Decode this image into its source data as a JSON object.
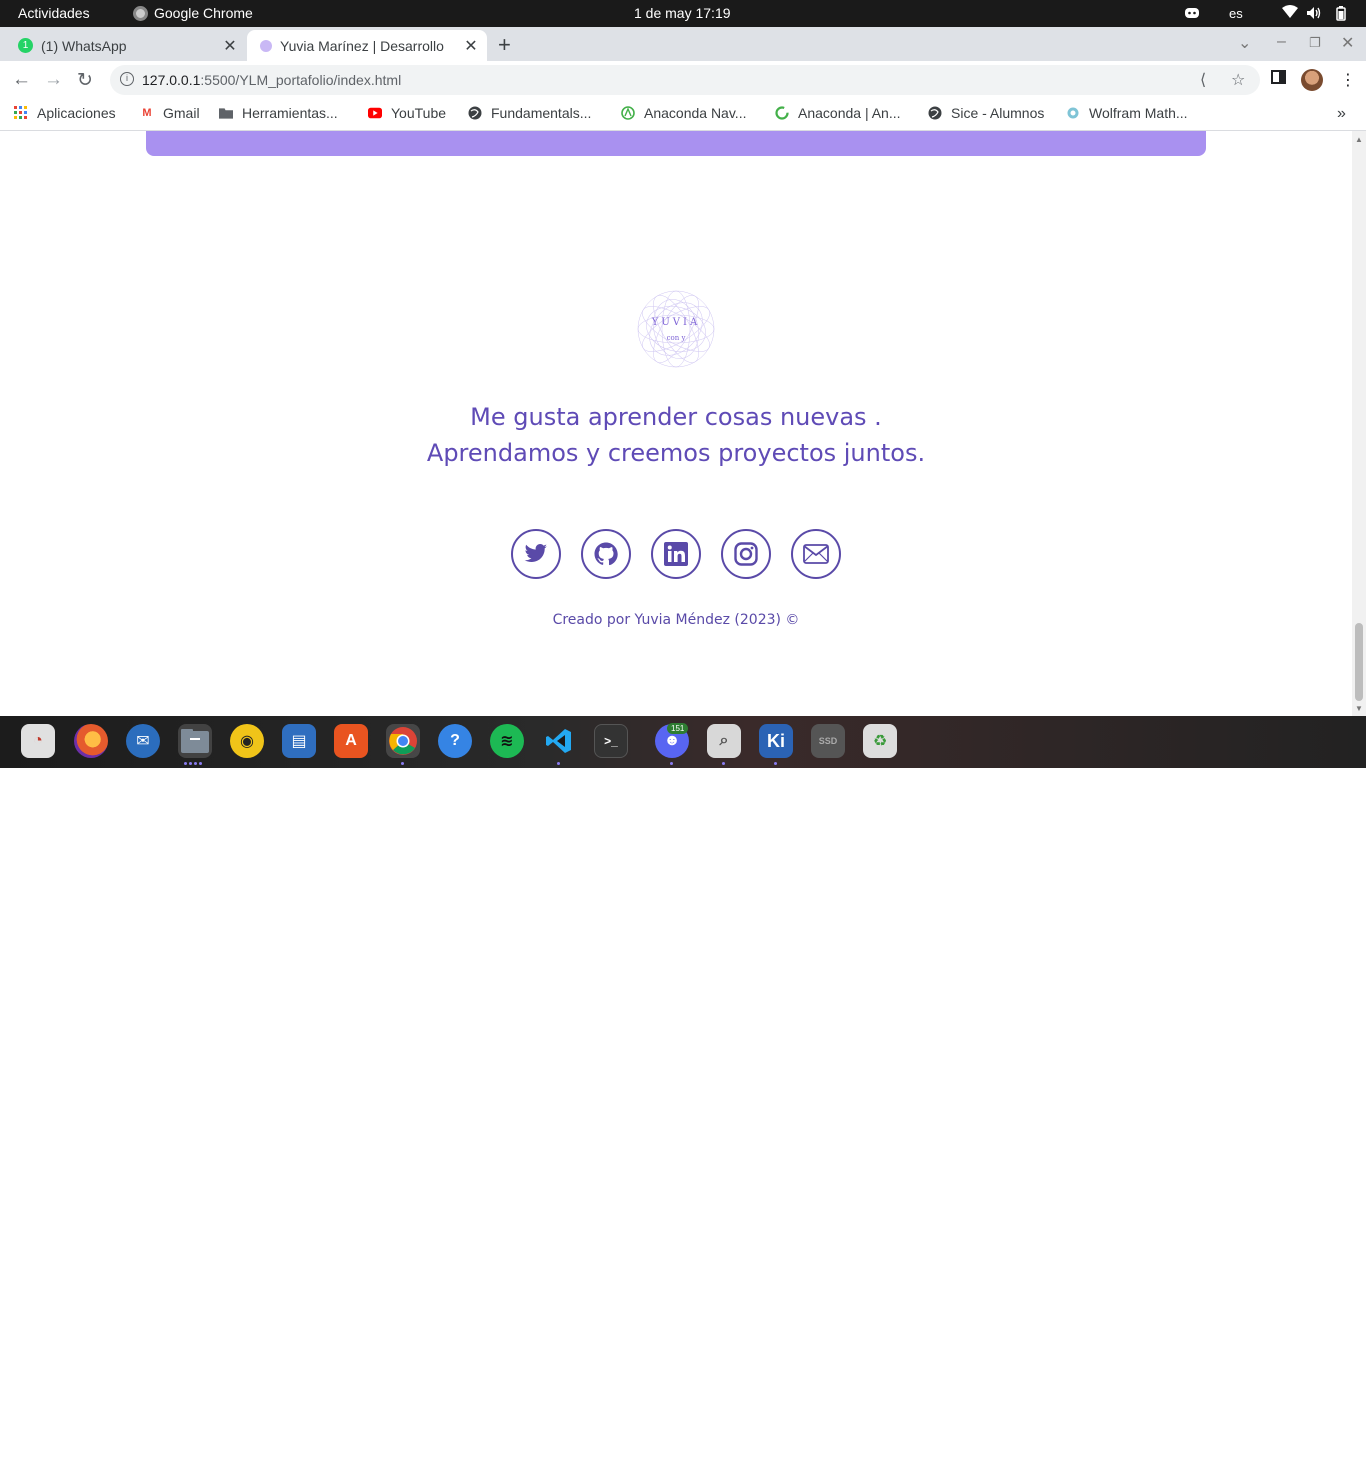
{
  "system_bar": {
    "activities": "Actividades",
    "app_name": "Google Chrome",
    "clock": "1 de may  17:19",
    "language": "es"
  },
  "tabs": [
    {
      "label": "(1) WhatsApp",
      "badge": "1"
    },
    {
      "label": "Yuvia Marínez | Desarrollo"
    }
  ],
  "omnibox": {
    "url_host": "127.0.0.1",
    "url_rest": ":5500/YLM_portafolio/index.html"
  },
  "bookmarks": [
    {
      "label": "Aplicaciones",
      "icon": "apps-grid-icon"
    },
    {
      "label": "Gmail",
      "icon": "gmail-icon"
    },
    {
      "label": "Herramientas...",
      "icon": "folder-icon"
    },
    {
      "label": "YouTube",
      "icon": "youtube-icon"
    },
    {
      "label": "Fundamentals...",
      "icon": "globe-icon"
    },
    {
      "label": "Anaconda Nav...",
      "icon": "anaconda-icon"
    },
    {
      "label": "Anaconda | An...",
      "icon": "anaconda-ring-icon"
    },
    {
      "label": "Sice - Alumnos",
      "icon": "globe-icon"
    },
    {
      "label": "Wolfram Math...",
      "icon": "wolfram-icon"
    }
  ],
  "page": {
    "logo_word": "YUVIA",
    "logo_sub": "con y",
    "tagline_line1": "Me gusta aprender cosas nuevas .",
    "tagline_line2": "Aprendamos y creemos proyectos juntos.",
    "socials": [
      "twitter-icon",
      "github-icon",
      "linkedin-icon",
      "instagram-icon",
      "mail-icon"
    ],
    "credit": "Creado por Yuvia Méndez (2023) ©"
  },
  "dock": {
    "discord_badge": "151"
  },
  "colors": {
    "accent": "#5a4aa8",
    "banner": "#a991f0",
    "tagline": "#5f4bb6"
  }
}
